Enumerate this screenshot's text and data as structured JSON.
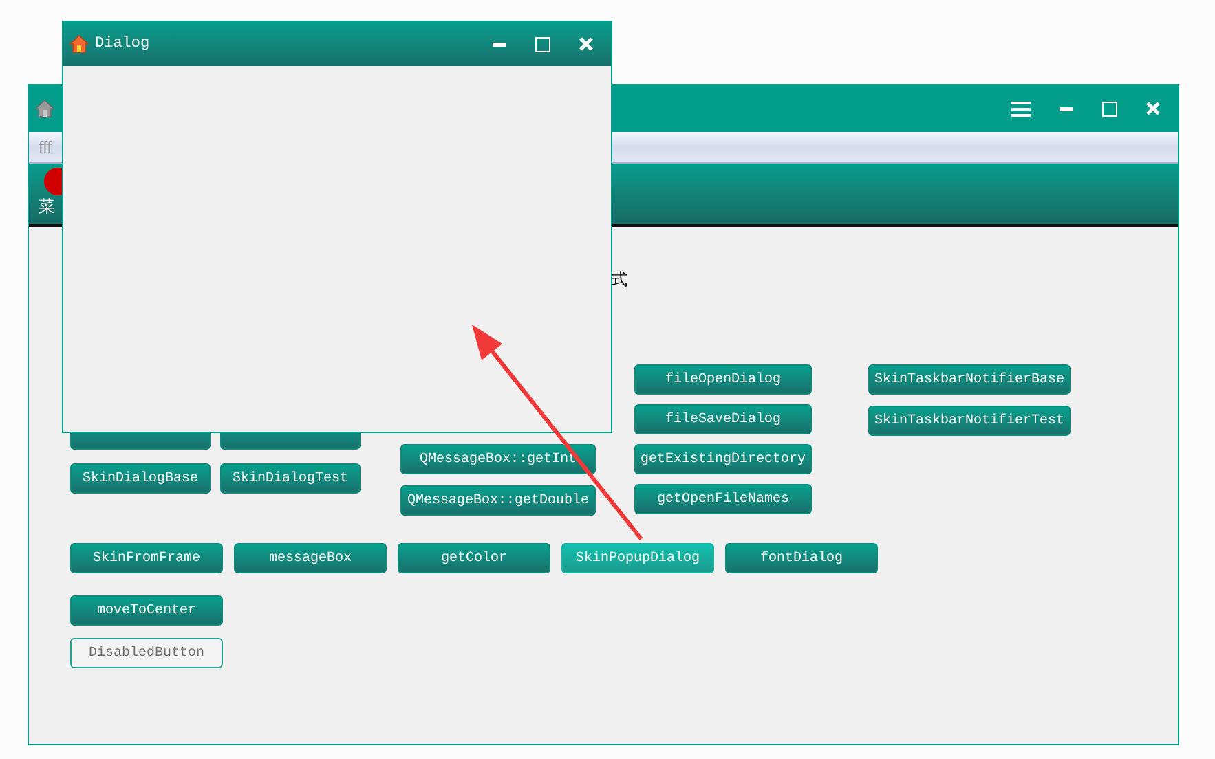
{
  "main_window": {
    "menu_bar": {
      "items": [
        "fff"
      ]
    },
    "toolbar": {
      "items": [
        {
          "label": "菜"
        }
      ]
    },
    "content": {
      "caption": "式",
      "columns": [
        {
          "rows": [
            [
              {
                "hovered": false,
                "disabled": false
              },
              {
                "hovered": false,
                "disabled": false
              }
            ],
            [
              {
                "label": "SkinDialogBase",
                "hovered": false,
                "disabled": false
              },
              {
                "label": "SkinDialogTest",
                "hovered": false,
                "disabled": false
              }
            ]
          ]
        },
        {
          "rows": [
            [
              {
                "label": "QMessageBox::getInt",
                "hovered": false,
                "disabled": false
              }
            ],
            [
              {
                "label": "QMessageBox::getDouble",
                "hovered": false,
                "disabled": false
              }
            ]
          ]
        },
        {
          "rows": [
            [
              {
                "label": "fileOpenDialog",
                "hovered": false,
                "disabled": false
              }
            ],
            [
              {
                "label": "fileSaveDialog",
                "hovered": false,
                "disabled": false
              }
            ],
            [
              {
                "label": "getExistingDirectory",
                "hovered": false,
                "disabled": false
              }
            ],
            [
              {
                "label": "getOpenFileNames",
                "hovered": false,
                "disabled": false
              }
            ]
          ]
        },
        {
          "rows": [
            [
              {
                "label": "SkinTaskbarNotifierBase",
                "hovered": false,
                "disabled": false
              }
            ],
            [
              {
                "label": "SkinTaskbarNotifierTest",
                "hovered": false,
                "disabled": false
              }
            ]
          ]
        }
      ],
      "bottom_row": [
        {
          "label": "SkinFromFrame",
          "hovered": false,
          "disabled": false
        },
        {
          "label": "messageBox",
          "hovered": false,
          "disabled": false
        },
        {
          "label": "getColor",
          "hovered": false,
          "disabled": false
        },
        {
          "label": "SkinPopupDialog",
          "hovered": true,
          "disabled": false
        },
        {
          "label": "fontDialog",
          "hovered": false,
          "disabled": false
        }
      ],
      "extra_buttons": [
        {
          "label": "moveToCenter",
          "hovered": false,
          "disabled": false
        },
        {
          "label": "DisabledButton",
          "hovered": false,
          "disabled": true
        }
      ]
    }
  },
  "dialog": {
    "title": "Dialog"
  }
}
